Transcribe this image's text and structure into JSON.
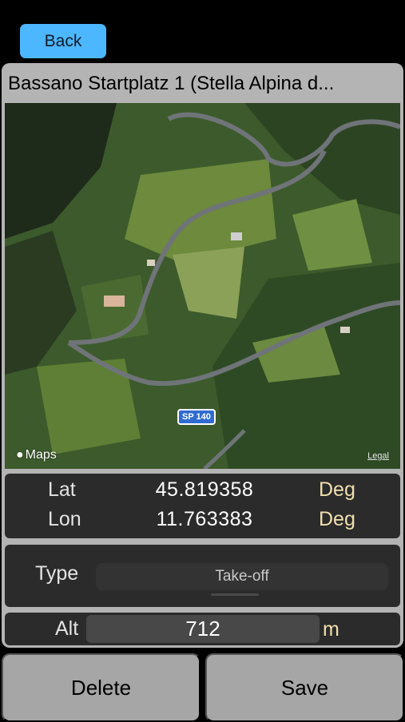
{
  "nav": {
    "back_label": "Back"
  },
  "header": {
    "title": "Bassano Startplatz 1 (Stella Alpina d..."
  },
  "map": {
    "provider_label": "Maps",
    "legal_label": "Legal",
    "road_badge": "SP 140"
  },
  "coords": {
    "lat_label": "Lat",
    "lat_value": "45.819358",
    "lat_unit": "Deg",
    "lon_label": "Lon",
    "lon_value": "11.763383",
    "lon_unit": "Deg"
  },
  "type": {
    "label": "Type",
    "value": "Take-off"
  },
  "altitude": {
    "label": "Alt",
    "value": "712",
    "unit": "m"
  },
  "actions": {
    "delete_label": "Delete",
    "save_label": "Save"
  },
  "colors": {
    "accent": "#4cb7ff",
    "unit_text": "#f1dfae",
    "panel": "#b4b4b4"
  }
}
